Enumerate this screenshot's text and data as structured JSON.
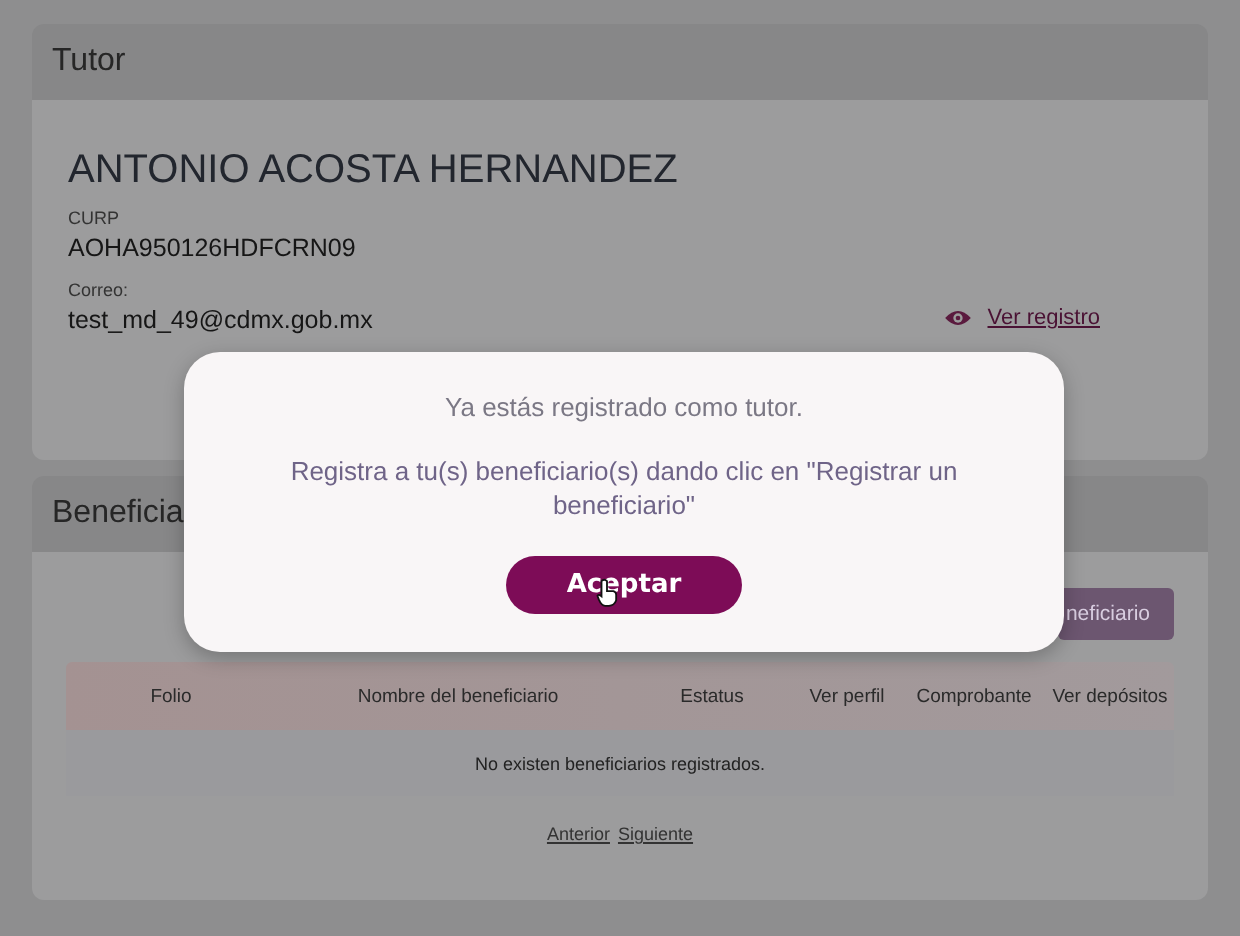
{
  "tutor": {
    "title": "Tutor",
    "name": "ANTONIO ACOSTA HERNANDEZ",
    "fields": [
      {
        "label": "CURP",
        "value": "AOHA950126HDFCRN09"
      },
      {
        "label": "Correo:",
        "value": "test_md_49@cdmx.gob.mx"
      }
    ],
    "link": "Ver registro"
  },
  "beneficiaries": {
    "title": "Beneficia",
    "add_button": "neficiario",
    "table": {
      "columns": [
        "Folio",
        "Nombre del beneficiario",
        "Estatus",
        "Ver perfil",
        "Comprobante",
        "Ver depósitos"
      ],
      "empty": "No existen beneficiarios registrados."
    },
    "pagination": [
      "Anterior",
      "Siguiente"
    ]
  },
  "modal": {
    "message": "Ya estás registrado como tutor.",
    "instruction": "Registra a tu(s) beneficiario(s) dando clic en \"Registrar un beneficiario\"",
    "button": "Aceptar"
  }
}
